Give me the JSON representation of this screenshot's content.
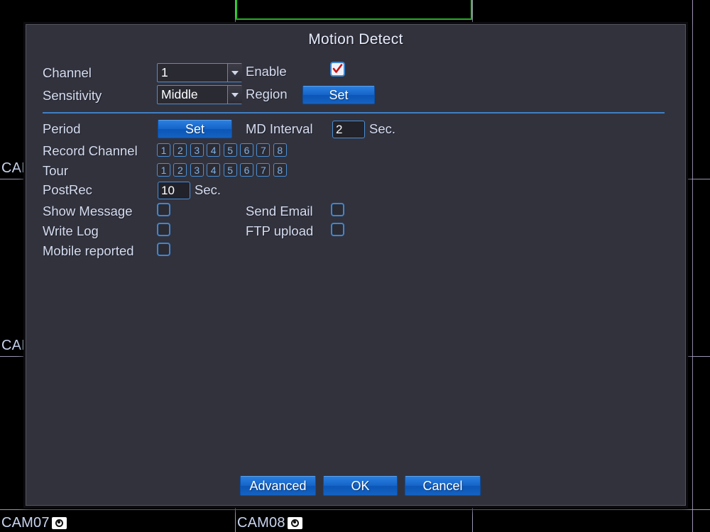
{
  "background": {
    "cam_labels": [
      {
        "name": "CAM07",
        "text": "CAM07"
      },
      {
        "name": "CAM08",
        "text": "CAM08"
      },
      {
        "name": "CAM-left-upper",
        "text": "CAM"
      },
      {
        "name": "CAM-left-lower",
        "text": "CAM"
      }
    ],
    "selected_cell_color": "#2fc22f",
    "divider_color": "#b9aed2"
  },
  "dialog": {
    "title": "Motion Detect",
    "background_color": "#32323d",
    "accent_color": "#1665c8",
    "separator_color": "#3f7fc4",
    "top_section": {
      "channel_label": "Channel",
      "channel_value": "1",
      "enable_label": "Enable",
      "enable_checked": true,
      "sensitivity_label": "Sensitivity",
      "sensitivity_value": "Middle",
      "region_label": "Region",
      "region_button": "Set"
    },
    "schedule_section": {
      "period_label": "Period",
      "period_button": "Set",
      "md_interval_label": "MD Interval",
      "md_interval_value": "2",
      "md_interval_unit": "Sec.",
      "record_channel_label": "Record Channel",
      "record_channels": [
        "1",
        "2",
        "3",
        "4",
        "5",
        "6",
        "7",
        "8"
      ],
      "tour_label": "Tour",
      "tour_channels": [
        "1",
        "2",
        "3",
        "4",
        "5",
        "6",
        "7",
        "8"
      ],
      "postrec_label": "PostRec",
      "postrec_value": "10",
      "postrec_unit": "Sec."
    },
    "alarm_options": {
      "show_message_label": "Show Message",
      "show_message_checked": false,
      "send_email_label": "Send Email",
      "send_email_checked": false,
      "write_log_label": "Write Log",
      "write_log_checked": false,
      "ftp_upload_label": "FTP upload",
      "ftp_upload_checked": false,
      "mobile_reported_label": "Mobile reported",
      "mobile_reported_checked": false
    },
    "footer": {
      "advanced_button": "Advanced",
      "ok_button": "OK",
      "cancel_button": "Cancel"
    }
  }
}
